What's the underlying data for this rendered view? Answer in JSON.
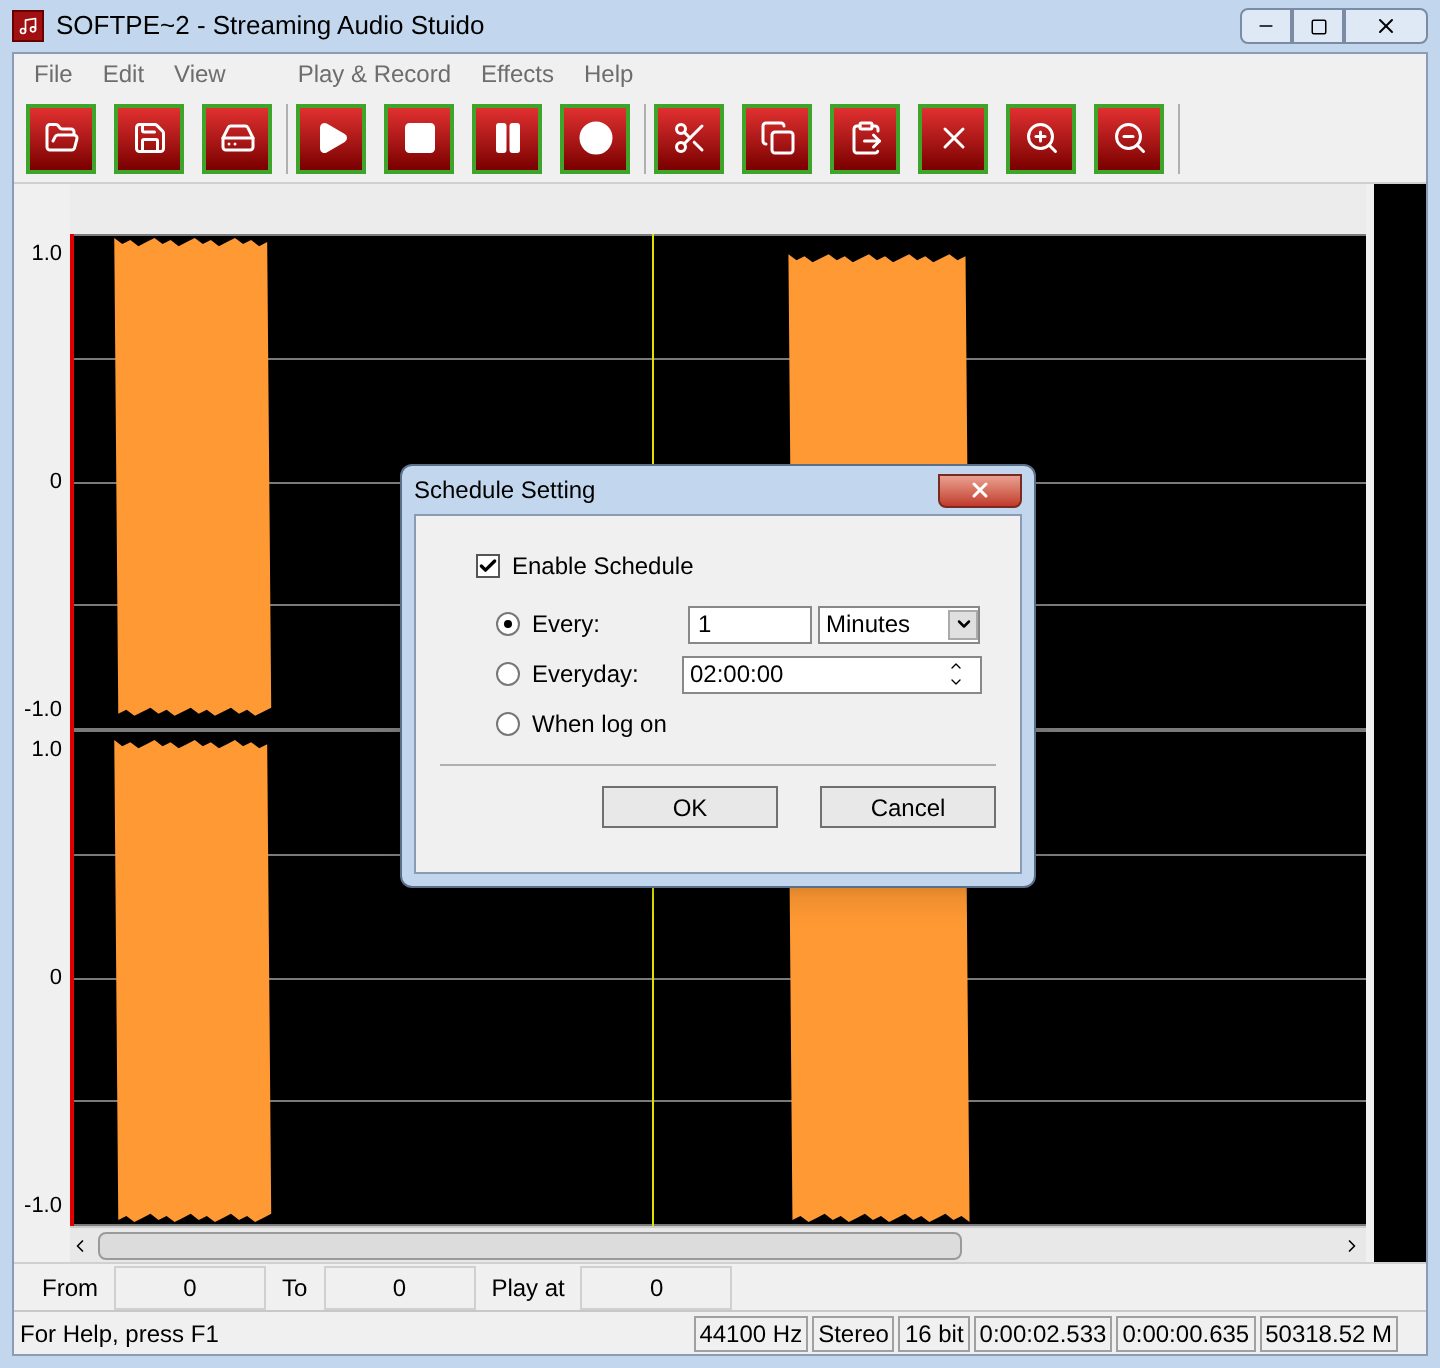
{
  "window": {
    "title": "SOFTPE~2 - Streaming Audio Stuido"
  },
  "menu": [
    {
      "label": "File"
    },
    {
      "label": "Edit"
    },
    {
      "label": "View"
    },
    {
      "label": "Play & Record"
    },
    {
      "label": "Effects"
    },
    {
      "label": "Help"
    }
  ],
  "toolbar": [
    [
      {
        "kind": "open"
      },
      {
        "kind": "save"
      },
      {
        "kind": "save-as"
      }
    ],
    [
      {
        "kind": "play"
      },
      {
        "kind": "stop"
      },
      {
        "kind": "pause"
      },
      {
        "kind": "record"
      }
    ],
    [
      {
        "kind": "cut"
      },
      {
        "kind": "copy"
      },
      {
        "kind": "paste"
      },
      {
        "kind": "delete"
      },
      {
        "kind": "zoom-in"
      },
      {
        "kind": "zoom-out"
      }
    ]
  ],
  "channels": [
    {
      "axis_labels": [
        "1.0",
        "0",
        "-1.0"
      ]
    },
    {
      "axis_labels": [
        "1.0",
        "0",
        "-1.0"
      ]
    }
  ],
  "dialog": {
    "title": "Schedule Setting",
    "enable": {
      "label": "Enable Schedule",
      "checked": true
    },
    "options": [
      {
        "kind": "interval",
        "label": "Every:",
        "selected": true,
        "value": "1",
        "unit": "Minutes"
      },
      {
        "kind": "time",
        "label": "Everyday:",
        "selected": false,
        "value": "02:00:00"
      },
      {
        "kind": "plain",
        "label": "When log on",
        "selected": false
      }
    ],
    "buttons": [
      "OK",
      "Cancel"
    ]
  },
  "range": [
    {
      "label": "From",
      "value": "0"
    },
    {
      "label": "To",
      "value": "0"
    },
    {
      "label": "Play at",
      "value": "0"
    }
  ],
  "status_bar": {
    "help": "For Help, press F1",
    "panes": [
      "44100 Hz",
      "Stereo",
      "16 bit",
      "0:00:02.533",
      "0:00:00.635",
      "50318.52 M"
    ]
  }
}
